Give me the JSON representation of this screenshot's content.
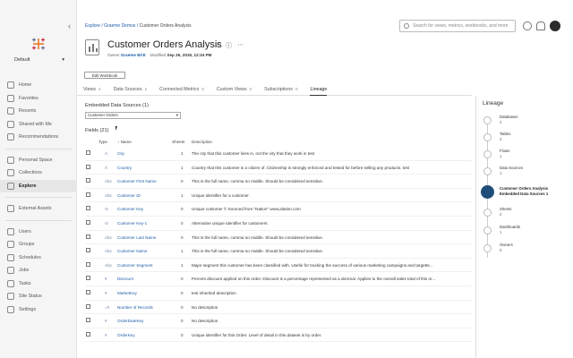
{
  "sidebar": {
    "site": "Default",
    "groups": [
      [
        {
          "label": "Home",
          "icon": "home-icon"
        },
        {
          "label": "Favorites",
          "icon": "star-icon"
        },
        {
          "label": "Recents",
          "icon": "clock-icon"
        },
        {
          "label": "Shared with Me",
          "icon": "shared-icon"
        },
        {
          "label": "Recommendations",
          "icon": "lightbulb-icon"
        }
      ],
      [
        {
          "label": "Personal Space",
          "icon": "person-icon"
        },
        {
          "label": "Collections",
          "icon": "collection-icon"
        },
        {
          "label": "Explore",
          "icon": "explore-icon",
          "active": true
        }
      ],
      [
        {
          "label": "External Assets",
          "icon": "database-icon"
        }
      ],
      [
        {
          "label": "Users",
          "icon": "user-icon"
        },
        {
          "label": "Groups",
          "icon": "group-icon"
        },
        {
          "label": "Schedules",
          "icon": "calendar-icon"
        },
        {
          "label": "Jobs",
          "icon": "jobs-icon"
        },
        {
          "label": "Tasks",
          "icon": "tasks-icon"
        },
        {
          "label": "Site Status",
          "icon": "status-icon"
        },
        {
          "label": "Settings",
          "icon": "gear-icon"
        }
      ]
    ]
  },
  "breadcrumb": {
    "explore": "Explore",
    "project": "Graeme Demos",
    "current": "Customer Orders Analysis"
  },
  "search": {
    "placeholder": "Search for views, metrics, workbooks, and more"
  },
  "header": {
    "title": "Customer Orders Analysis",
    "owner_label": "Owner",
    "owner": "Graeme Britt",
    "modified_label": "Modified",
    "modified": "Sep 26, 2019, 12:34 PM",
    "edit_button": "Edit Workbook"
  },
  "tabs": [
    {
      "label": "Views",
      "count": "4"
    },
    {
      "label": "Data Sources",
      "count": "1"
    },
    {
      "label": "Connected Metrics",
      "count": "0"
    },
    {
      "label": "Custom Views",
      "count": "0"
    },
    {
      "label": "Subscriptions",
      "count": "0"
    },
    {
      "label": "Lineage",
      "count": "",
      "active": true
    }
  ],
  "content": {
    "embedded_title": "Embedded Data Sources (1)",
    "selected_source": "Customer Orders",
    "fields_title": "Fields (21)",
    "columns": {
      "type": "Type",
      "name": "↑ Name",
      "sheets": "Sheets",
      "description": "Description"
    },
    "fields": [
      {
        "type": "Á",
        "name": "City",
        "sheets": "1",
        "description": "The city that this customer lives in, not the city that they work in test"
      },
      {
        "type": "Á",
        "name": "Country",
        "sheets": "1",
        "description": "Country that this customer is a citizen of. Citizenship is strongly enforced and tested for before selling any products. test"
      },
      {
        "type": "Abc",
        "name": "Customer First Name",
        "sheets": "0",
        "description": "This is the full name, comma no middle. Should be considered sensitive."
      },
      {
        "type": "Abc",
        "name": "Customer ID",
        "sheets": "1",
        "description": "Unique identifier for a customer."
      },
      {
        "type": "⊙",
        "name": "Customer Key",
        "sheets": "0",
        "description": "Unique customer © Sourced from \"Nation\" www.alation.com"
      },
      {
        "type": "⊙",
        "name": "Customer Key-1",
        "sheets": "0",
        "description": "Alternative unique identifier for customers"
      },
      {
        "type": "Abc",
        "name": "Customer Last Name",
        "sheets": "0",
        "description": "This is the full name, comma no middle. Should be considered sensitive."
      },
      {
        "type": "Abc",
        "name": "Customer Name",
        "sheets": "1",
        "description": "This is the full name, comma no middle. Should be considered sensitive."
      },
      {
        "type": "Abc",
        "name": "Customer Segment",
        "sheets": "1",
        "description": "Major segment this customer has been classified with. Useful for tracking the success of various marketing campaigns and targette..."
      },
      {
        "type": "#",
        "name": "Discount",
        "sheets": "0",
        "description": "Percent discount applied on this order. Discount is a percentage represented as a decimal. Applies to the overall sales total of this or..."
      },
      {
        "type": "#",
        "name": "MarketKey",
        "sheets": "0",
        "description": "test inherited description"
      },
      {
        "type": "=#",
        "name": "Number of Records",
        "sheets": "0",
        "description": "No description"
      },
      {
        "type": "#",
        "name": "OrderDateKey",
        "sheets": "0",
        "description": "No description"
      },
      {
        "type": "#",
        "name": "OrderKey",
        "sheets": "0",
        "description": "Unique identifier for this Order. Level of detail in this dataset is by order."
      }
    ]
  },
  "lineage": {
    "title": "Lineage",
    "items": [
      {
        "label": "Databases",
        "count": "2",
        "icon": "database-icon"
      },
      {
        "label": "Tables",
        "count": "3",
        "icon": "table-icon"
      },
      {
        "label": "Flows",
        "count": "1",
        "icon": "flow-icon"
      },
      {
        "label": "Data Sources",
        "count": "1",
        "icon": "datasource-icon"
      },
      {
        "label": "Customer Orders Analysis",
        "count": "Embedded Data Sources 1",
        "icon": "workbook-icon",
        "selected": true
      },
      {
        "label": "Sheets",
        "count": "2",
        "icon": "sheet-icon"
      },
      {
        "label": "Dashboards",
        "count": "1",
        "icon": "dashboard-icon"
      },
      {
        "label": "Owners",
        "count": "0",
        "icon": "owner-icon"
      }
    ]
  }
}
